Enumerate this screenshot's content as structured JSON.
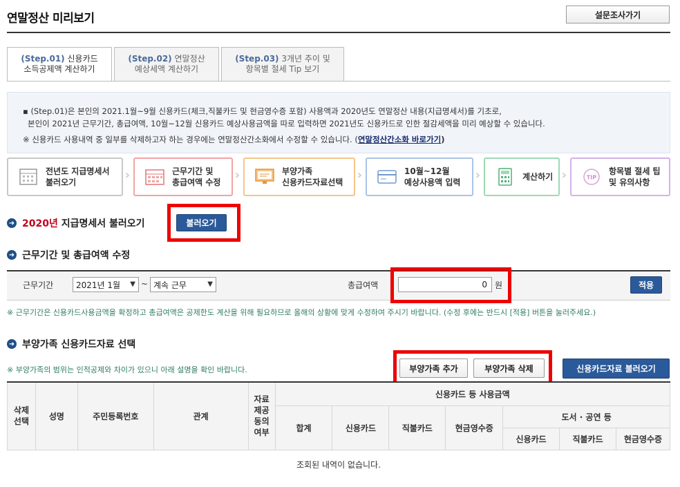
{
  "page": {
    "title": "연말정산 미리보기",
    "survey_button": "설문조사가기"
  },
  "tabs": [
    {
      "step": "(Step.01)",
      "line1": " 신용카드",
      "line2": "소득공제액 계산하기"
    },
    {
      "step": "(Step.02)",
      "line1": " 연말정산",
      "line2": "예상세액 계산하기"
    },
    {
      "step": "(Step.03)",
      "line1": " 3개년 추이 및",
      "line2": "항목별 절세 Tip 보기"
    }
  ],
  "notice": {
    "line1": "▪ (Step.01)은 본인의 2021.1월~9월 신용카드(체크,직불카드 및 현금영수증 포함) 사용액과 2020년도 연말정산 내용(지급명세서)를 기초로,",
    "line2": "본인이 2021년 근무기간, 총급여액, 10월~12월 신용카드 예상사용금액을 따로 입력하면 2021년도 신용카드로 인한 절감세액을 미리 예상할 수 있습니다.",
    "line3": "※ 신용카드 사용내역 중 일부를 삭제하고자 하는 경우에는 연말정산간소화에서 수정할 수 있습니다. (",
    "link": "연말정산간소화 바로가기",
    "line3_end": ")"
  },
  "process_steps": [
    {
      "line1": "전년도 지급명세서",
      "line2": "불러오기",
      "color": "#bbbbbb",
      "icon": "document-icon"
    },
    {
      "line1": "근무기간 및",
      "line2": "총급여액 수정",
      "color": "#f2a3a3",
      "icon": "calendar-icon"
    },
    {
      "line1": "부양가족",
      "line2": "신용카드자료선택",
      "color": "#f5c58a",
      "icon": "monitor-icon"
    },
    {
      "line1": "10월~12월",
      "line2": "예상사용액 입력",
      "color": "#a9c4e6",
      "icon": "card-icon"
    },
    {
      "line1": "계산하기",
      "line2": "",
      "color": "#9fd9b5",
      "icon": "calculator-icon"
    },
    {
      "line1": "항목별 절세 팁",
      "line2": "및 유의사항",
      "color": "#d2b3e8",
      "icon": "tip-icon"
    }
  ],
  "section1": {
    "year": "2020년",
    "title": " 지급명세서 불러오기",
    "load_button": "불러오기"
  },
  "section2": {
    "title": "근무기간 및 총급여액 수정",
    "period_label": "근무기간",
    "start_value": "2021년 1월",
    "tilde": "~",
    "end_value": "계속 근무",
    "salary_label": "총급여액",
    "salary_value": "0",
    "unit": "원",
    "apply_button": "적용",
    "note": "※ 근무기간은 신용카드사용금액을 확정하고 총급여액은 공제한도 계산을 위해 필요하므로 올해의 상황에 맞게 수정하여 주시기 바랍니다. (수정 후에는 반드시 [적용] 버튼을 눌러주세요.)"
  },
  "section3": {
    "title": "부양가족 신용카드자료 선택",
    "note": "※ 부양가족의 범위는 인적공제와 차이가 있으니 아래 설명을 확인 바랍니다.",
    "add_button": "부양가족 추가",
    "delete_button": "부양가족 삭제",
    "load_card_button": "신용카드자료 불러오기"
  },
  "table": {
    "col_delete": [
      "삭제",
      "선택"
    ],
    "col_name": "성명",
    "col_rrn": "주민등록번호",
    "col_relation": "관계",
    "col_provide": [
      "자료",
      "제공",
      "동의",
      "여부"
    ],
    "group_usage": "신용카드 등 사용금액",
    "col_total": "합계",
    "col_credit": "신용카드",
    "col_debit": "직불카드",
    "col_cash": "현금영수증",
    "group_books": "도서 · 공연 등",
    "sub_credit": "신용카드",
    "sub_debit": "직불카드",
    "sub_cash": "현금영수증",
    "empty_message": "조회된 내역이 없습니다."
  }
}
